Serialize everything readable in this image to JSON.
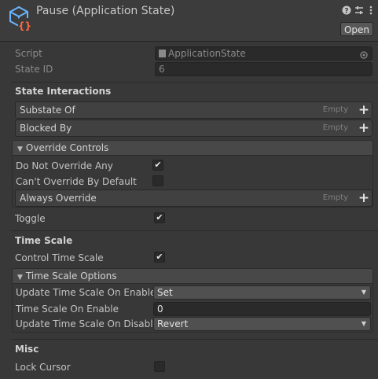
{
  "header": {
    "title": "Pause (Application State)",
    "icon": "cube-script-icon",
    "help_icon": "help-icon",
    "settings_icon": "preset-sliders-icon",
    "more_icon": "kebab-menu-icon",
    "open_label": "Open"
  },
  "script_row": {
    "label": "Script",
    "value": "ApplicationState",
    "file_icon": "script-file-icon",
    "target_icon": "object-picker-icon"
  },
  "state_id_row": {
    "label": "State ID",
    "value": "6"
  },
  "state_interactions": {
    "title": "State Interactions",
    "substate_of": {
      "label": "Substate Of",
      "empty": "Empty"
    },
    "blocked_by": {
      "label": "Blocked By",
      "empty": "Empty"
    },
    "override_controls": {
      "title": "Override Controls",
      "expanded": true,
      "do_not_override_any": {
        "label": "Do Not Override Any",
        "checked": true
      },
      "cant_override_by_default": {
        "label": "Can't Override By Default",
        "checked": false
      },
      "always_override": {
        "label": "Always Override",
        "empty": "Empty"
      }
    },
    "toggle": {
      "label": "Toggle",
      "checked": true
    }
  },
  "time_scale": {
    "title": "Time Scale",
    "control_time_scale": {
      "label": "Control Time Scale",
      "checked": true
    },
    "options": {
      "title": "Time Scale Options",
      "expanded": true,
      "update_on_enable": {
        "label": "Update Time Scale On Enable",
        "value": "Set"
      },
      "time_scale_on_enable": {
        "label": "Time Scale On Enable",
        "value": "0"
      },
      "update_on_disable": {
        "label": "Update Time Scale On Disable",
        "value": "Revert"
      }
    }
  },
  "misc": {
    "title": "Misc",
    "lock_cursor": {
      "label": "Lock Cursor",
      "checked": false
    }
  },
  "glyphs": {
    "check": "✔",
    "plus": "+",
    "triangle": "▼",
    "caret": "▼"
  },
  "colors": {
    "background": "#383838",
    "field": "#2a2a2a",
    "header": "#3c3c3c",
    "accent_icon": "#6ab4ff",
    "brace_icon": "#ff6a3d"
  }
}
